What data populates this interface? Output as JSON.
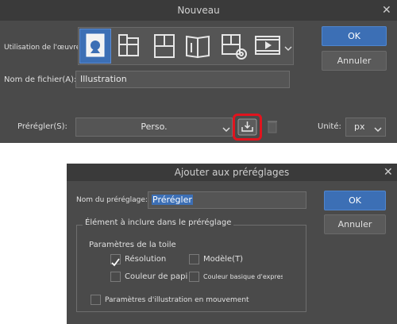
{
  "nouveau": {
    "title": "Nouveau",
    "usage_label": "Utilisation de l'œuvre",
    "filename_label": "Nom de fichier(A):",
    "filename_value": "Illustration",
    "preset_label": "Prérégler(S):",
    "preset_value": "Perso.",
    "unit_label": "Unité:",
    "unit_value": "px",
    "ok_label": "OK",
    "cancel_label": "Annuler"
  },
  "ajouter": {
    "title": "Ajouter aux préréglages",
    "name_label": "Nom du préréglage:",
    "name_value": "Prérégler",
    "group_title": "Élément à inclure dans le préréglage",
    "canvas_params_label": "Paramètres de la toile",
    "resolution_label": "Résolution",
    "modele_label": "Modèle(T)",
    "couleur_label": "Couleur de papi",
    "couleur_basique_label": "Couleur basique d'express",
    "anim_label": "Paramètres d'illustration en mouvement",
    "ok_label": "OK",
    "cancel_label": "Annuler",
    "checks": {
      "resolution": true,
      "modele": false,
      "couleur": false,
      "couleur_basique": false,
      "anim": false
    }
  },
  "colors": {
    "accent": "#3c6fb5",
    "highlight_ring": "#e0141e"
  }
}
